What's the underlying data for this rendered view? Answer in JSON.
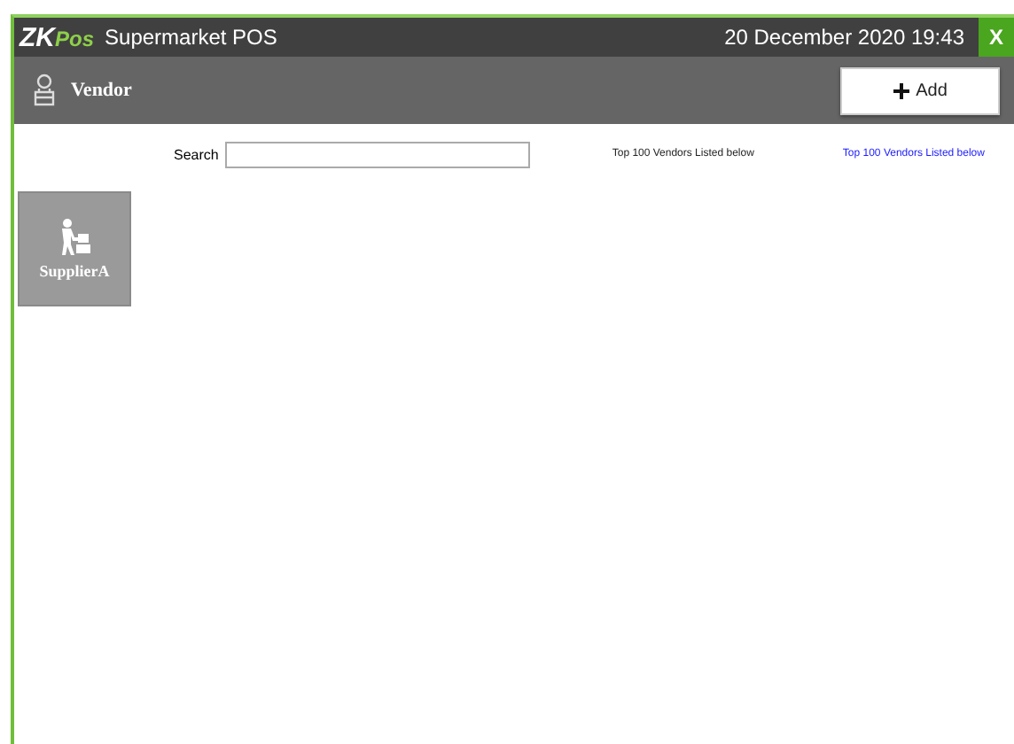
{
  "window": {
    "logo_main": "ZK",
    "logo_accent": "Pos",
    "title": "Supermarket POS",
    "datetime": "20 December 2020 19:43",
    "close": "X"
  },
  "toolbar": {
    "title": "Vendor",
    "add_button": "Add"
  },
  "search": {
    "label": "Search"
  },
  "notes": [
    "Top 100 Vendors Listed below",
    "Top 100 Vendors Listed below"
  ],
  "vendors": [
    {
      "name": "SupplierA"
    }
  ]
}
